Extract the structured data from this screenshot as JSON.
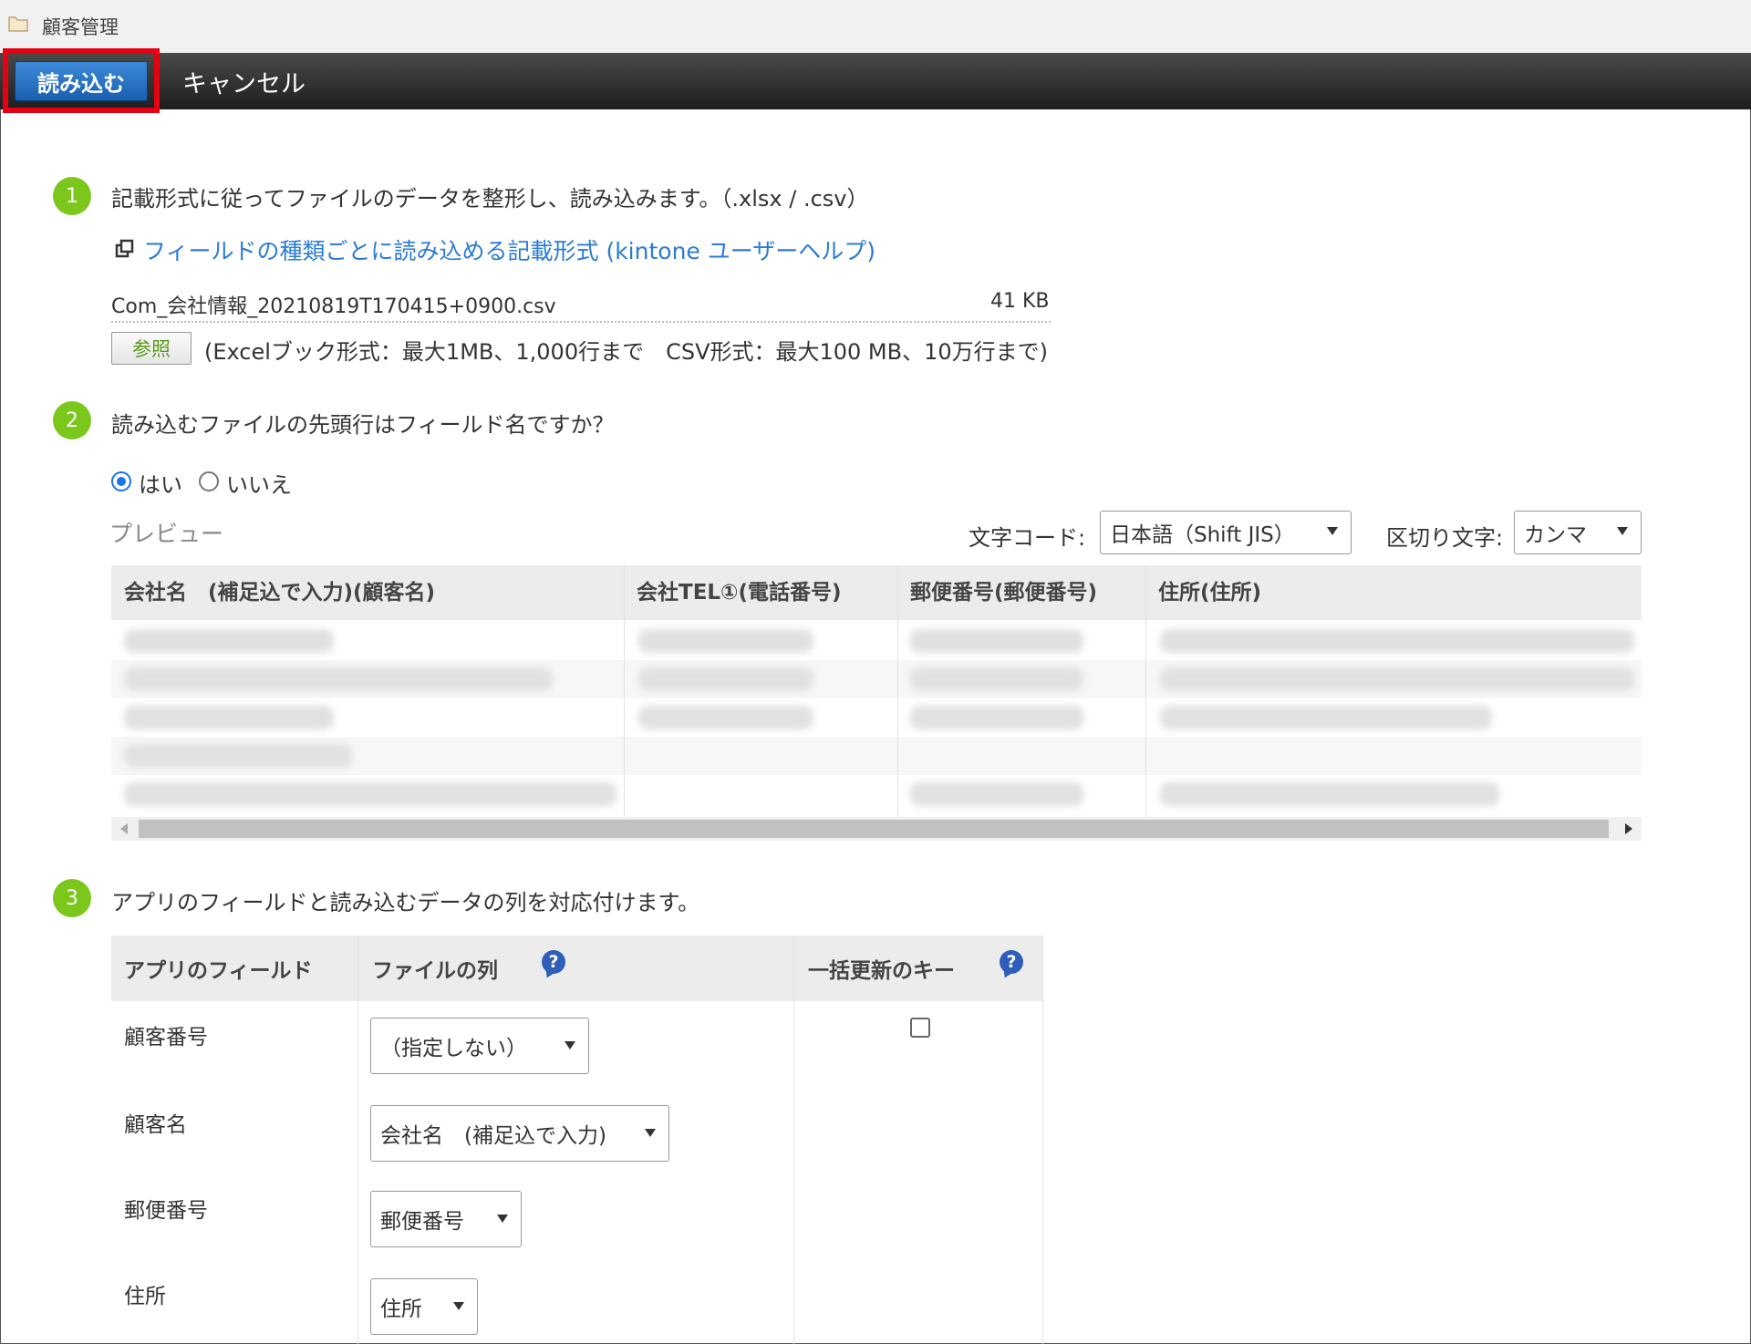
{
  "window": {
    "title": "顧客管理"
  },
  "toolbar": {
    "import_label": "読み込む",
    "cancel_label": "キャンセル"
  },
  "step1": {
    "number": "1",
    "text": "記載形式に従ってファイルのデータを整形し、読み込みます。（.xlsx / .csv）",
    "help_link": "フィールドの種類ごとに読み込める記載形式 (kintone ユーザーヘルプ)",
    "file_name": "Com_会社情報_20210819T170415+0900.csv",
    "file_size": "41 KB",
    "browse_label": "参照",
    "limit_text": "(Excelブック形式：最大1MB、1,000行まで　CSV形式：最大100 MB、10万行まで)"
  },
  "step2": {
    "number": "2",
    "text": "読み込むファイルの先頭行はフィールド名ですか？",
    "option_yes": "はい",
    "option_no": "いいえ",
    "selected": "はい",
    "preview_label": "プレビュー",
    "encoding_label": "文字コード:",
    "encoding_value": "日本語（Shift JIS）",
    "delimiter_label": "区切り文字:",
    "delimiter_value": "カンマ",
    "preview_columns": [
      "会社名　(補足込で入力)(顧客名)",
      "会社TEL①(電話番号)",
      "郵便番号(郵便番号)",
      "住所(住所)"
    ]
  },
  "step3": {
    "number": "3",
    "text": "アプリのフィールドと読み込むデータの列を対応付けます。",
    "columns": {
      "app_field": "アプリのフィールド",
      "file_column": "ファイルの列",
      "update_key": "一括更新のキー"
    },
    "help_icon_glyph": "?",
    "rows": [
      {
        "field": "顧客番号",
        "column": "（指定しない）"
      },
      {
        "field": "顧客名",
        "column": "会社名　(補足込で入力)"
      },
      {
        "field": "郵便番号",
        "column": "郵便番号"
      },
      {
        "field": "住所",
        "column": "住所"
      }
    ]
  },
  "colors": {
    "accent_green": "#7bc71c",
    "link_blue": "#2b7bd6",
    "highlight_red": "#e50012",
    "button_blue": "#1a5fb0"
  }
}
